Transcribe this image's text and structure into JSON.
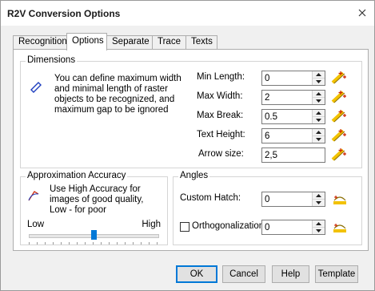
{
  "window": {
    "title": "R2V Conversion Options"
  },
  "tabs": [
    {
      "label": "Recognition"
    },
    {
      "label": "Options"
    },
    {
      "label": "Separate"
    },
    {
      "label": "Trace"
    },
    {
      "label": "Texts"
    }
  ],
  "active_tab": "Options",
  "dimensions": {
    "title": "Dimensions",
    "description_lines": [
      "You can define maximum width",
      "and minimal length of raster",
      "objects to be recognized, and",
      "maximum gap to be ignored"
    ],
    "fields": {
      "min_length": {
        "label": "Min Length:",
        "value": "0"
      },
      "max_width": {
        "label": "Max Width:",
        "value": "2"
      },
      "max_break": {
        "label": "Max Break:",
        "value": "0.5"
      },
      "text_height": {
        "label": "Text Height:",
        "value": "6"
      },
      "arrow_size": {
        "label": "Arrow size:",
        "value": "2,5"
      }
    }
  },
  "approximation": {
    "title": "Approximation Accuracy",
    "description_lines": [
      "Use High Accuracy  for",
      "images of good quality,",
      "Low - for poor"
    ],
    "low_label": "Low",
    "high_label": "High",
    "slider_position": 0.5
  },
  "angles": {
    "title": "Angles",
    "custom_hatch": {
      "label": "Custom Hatch:",
      "value": "0"
    },
    "orthogonalization": {
      "label": "Orthogonalization",
      "value": "0",
      "checked": false
    }
  },
  "buttons": {
    "ok": "OK",
    "cancel": "Cancel",
    "help": "Help",
    "template": "Template"
  },
  "colors": {
    "accent": "#0078d7",
    "icon_yellow": "#f2c200",
    "icon_red": "#cc2200",
    "icon_blue": "#1f3fbf"
  }
}
